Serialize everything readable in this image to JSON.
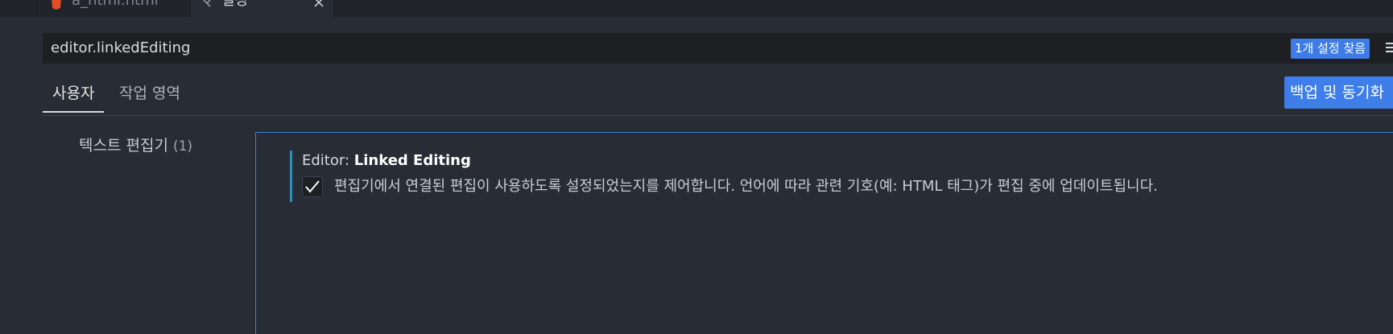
{
  "tabs": [
    {
      "label": "a_html.html",
      "icon": "html5-icon"
    },
    {
      "label": "설정",
      "icon": "settings-file-icon"
    }
  ],
  "search": {
    "value": "editor.linkedEditing",
    "result_count": "1개 설정 찾음"
  },
  "scopes": {
    "user": "사용자",
    "workspace": "작업 영역"
  },
  "sync_button": "백업 및 동기화",
  "toc": {
    "label": "텍스트 편집기",
    "count": "(1)"
  },
  "setting": {
    "category": "Editor: ",
    "name": "Linked Editing",
    "checked": true,
    "description": "편집기에서 연결된 편집이 사용하도록 설정되었는지를 제어합니다. 언어에 따라 관련 기호(예: HTML 태그)가 편집 중에 업데이트됩니다."
  },
  "colors": {
    "background": "#282c34",
    "accent": "#3d7ce6",
    "focus_border": "#2a8fbd"
  }
}
